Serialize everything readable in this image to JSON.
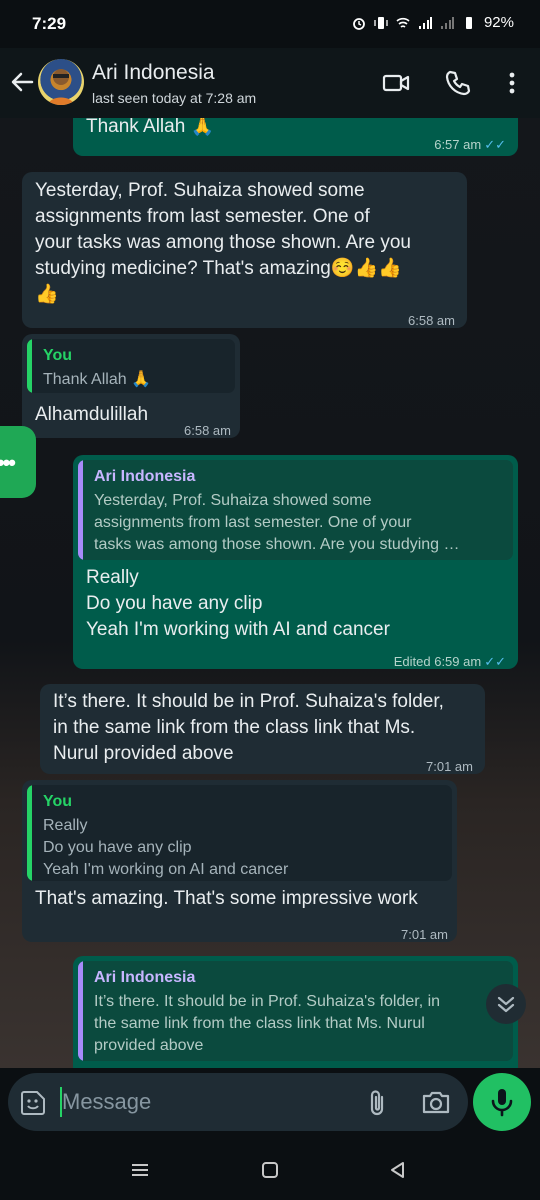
{
  "status_bar": {
    "time": "7:29",
    "battery": "92%"
  },
  "header": {
    "contact_name": "Ari Indonesia",
    "last_seen": "last seen today at 7:28 am"
  },
  "colors": {
    "accent": "#25d366",
    "incoming_bubble": "#1f2c34",
    "outgoing_bubble": "#005c4b",
    "read_ticks": "#53bdeb"
  },
  "messages": [
    {
      "direction": "out",
      "text": "Thank Allah 🙏",
      "time": "6:57 am",
      "status": "read"
    },
    {
      "direction": "in",
      "text": "Yesterday, Prof. Suhaiza showed some\nassignments from last semester. One of\nyour tasks was among those shown. Are you\nstudying medicine? That's amazing☺️👍👍\n👍",
      "time": "6:58 am"
    },
    {
      "direction": "in",
      "reply_to": {
        "name": "You",
        "text": "Thank Allah 🙏"
      },
      "text": "Alhamdulillah",
      "time": "6:58 am"
    },
    {
      "direction": "out",
      "reply_to": {
        "name": "Ari Indonesia",
        "text": "Yesterday, Prof. Suhaiza showed some\nassignments from last semester. One of your\ntasks was among those shown. Are you studying …"
      },
      "text": "Really\nDo you have any clip\nYeah I'm working with AI and cancer",
      "time": "6:59 am",
      "edited_label": "Edited",
      "status": "read"
    },
    {
      "direction": "in",
      "text": "It’s there. It should be in Prof. Suhaiza's folder,\nin the same link from the class link that Ms.\nNurul provided above",
      "time": "7:01 am"
    },
    {
      "direction": "in",
      "reply_to": {
        "name": "You",
        "text": "Really\nDo you have any clip\nYeah I'm working on AI and cancer"
      },
      "text": "That's amazing. That's some impressive work",
      "time": "7:01 am"
    },
    {
      "direction": "out",
      "reply_to": {
        "name": "Ari Indonesia",
        "text": "It’s there. It should be in Prof. Suhaiza's folder, in\nthe same link from the class link that Ms. Nurul\nprovided above"
      },
      "text": ""
    }
  ],
  "composer": {
    "placeholder": "Message"
  },
  "icons": {
    "back": "arrow-left-icon",
    "video": "video-call-icon",
    "voice": "phone-icon",
    "menu": "more-vert-icon",
    "sticker": "sticker-icon",
    "attach": "paperclip-icon",
    "camera": "camera-icon",
    "mic": "mic-icon",
    "scroll_down": "chevron-double-down-icon"
  }
}
